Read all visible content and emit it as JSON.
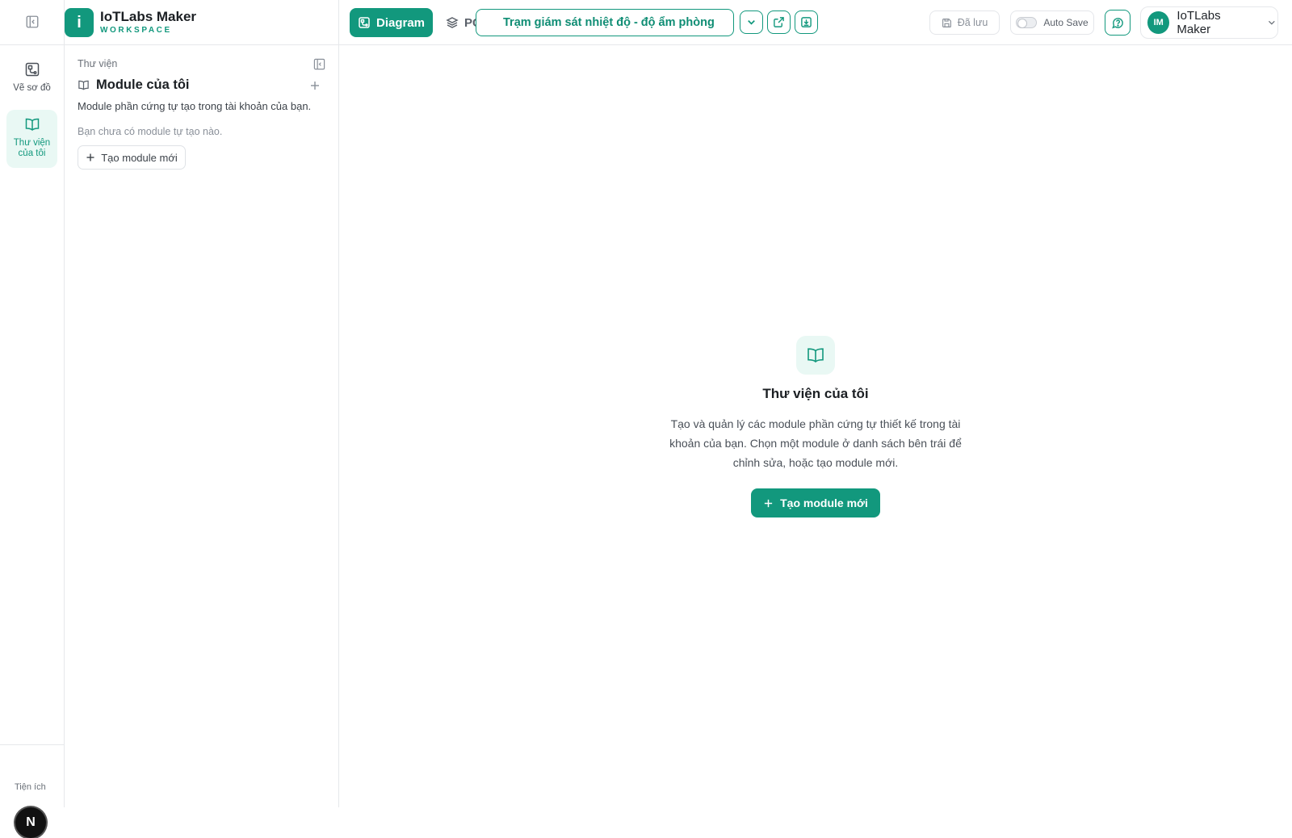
{
  "brand": {
    "logo_letter": "i",
    "name": "IoTLabs Maker",
    "subtitle": "WORKSPACE"
  },
  "header": {
    "tabs": [
      {
        "label": "Diagram",
        "icon": "diagram-icon",
        "active": true
      },
      {
        "label": "PCB",
        "icon": "layers-icon",
        "active": false
      }
    ],
    "project_name": "Trạm giám sát nhiệt độ - độ ẩm phòng",
    "saved_label": "Đã lưu",
    "autosave_label": "Auto Save",
    "autosave_on": false,
    "user": {
      "initials": "IM",
      "name": "IoTLabs Maker"
    }
  },
  "rail": {
    "items": [
      {
        "label": "Vẽ sơ đồ",
        "icon": "diagram-icon",
        "active": false
      },
      {
        "label": "Thư viện của tôi",
        "icon": "book-icon",
        "active": true
      }
    ],
    "bottom_label": "Tiện ích",
    "next_badge": "N"
  },
  "panel": {
    "kicker": "Thư viện",
    "title": "Module của tôi",
    "description": "Module phần cứng tự tạo trong tài khoản của bạn.",
    "empty_text": "Bạn chưa có module tự tạo nào.",
    "new_button": "Tạo module mới"
  },
  "main": {
    "empty_title": "Thư viện của tôi",
    "empty_description": "Tạo và quản lý các module phần cứng tự thiết kế trong tài khoản của bạn. Chọn một module ở danh sách bên trái để chỉnh sửa, hoặc tạo module mới.",
    "cta_label": "Tạo module mới"
  },
  "colors": {
    "accent": "#12987d",
    "accent_soft": "#e9f8f4",
    "border": "#e6e8eb"
  }
}
